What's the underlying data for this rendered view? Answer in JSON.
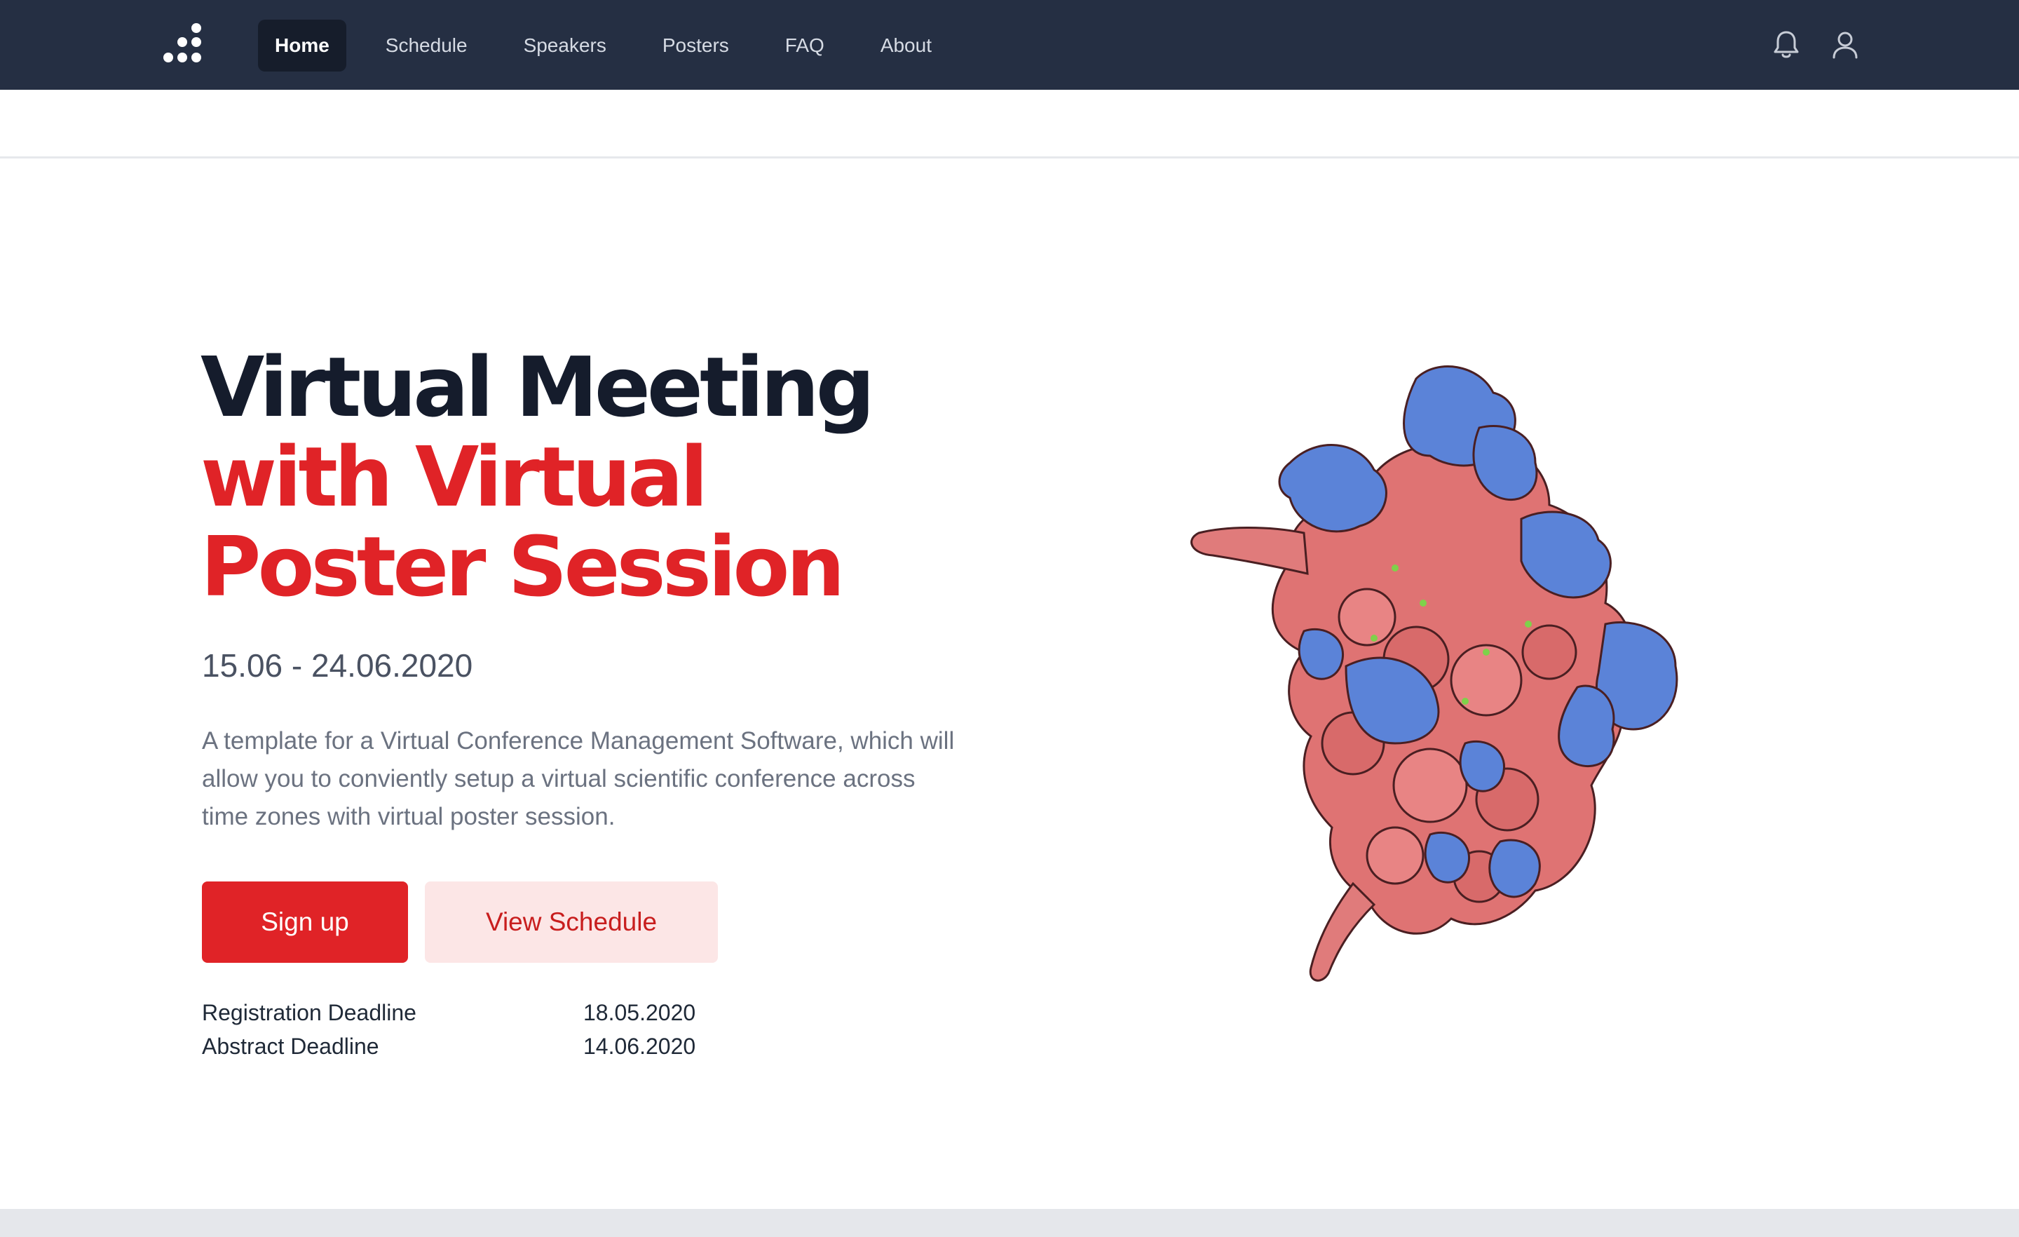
{
  "nav": {
    "links": [
      {
        "label": "Home",
        "active": true
      },
      {
        "label": "Schedule",
        "active": false
      },
      {
        "label": "Speakers",
        "active": false
      },
      {
        "label": "Posters",
        "active": false
      },
      {
        "label": "FAQ",
        "active": false
      },
      {
        "label": "About",
        "active": false
      }
    ],
    "icons": [
      "logo-dots-icon",
      "bell-icon",
      "user-icon"
    ]
  },
  "hero": {
    "title_line1": "Virtual Meeting",
    "title_line2": "with Virtual",
    "title_line3": "Poster Session",
    "dates": "15.06 - 24.06.2020",
    "description": "A template for a Virtual Conference Management Software, which will allow you to conviently setup a virtual scientific conference across time zones with virtual poster session.",
    "signup_label": "Sign up",
    "schedule_label": "View Schedule"
  },
  "deadlines": [
    {
      "label": "Registration Deadline",
      "date": "18.05.2020"
    },
    {
      "label": "Abstract Deadline",
      "date": "14.06.2020"
    }
  ],
  "colors": {
    "nav_bg": "#252f43",
    "nav_active_bg": "#161d2b",
    "title_dark": "#151c2c",
    "accent_red": "#e02327",
    "button_secondary_bg": "#fce6e6",
    "molecule_red": "#df7373",
    "molecule_blue": "#5b83d8"
  }
}
